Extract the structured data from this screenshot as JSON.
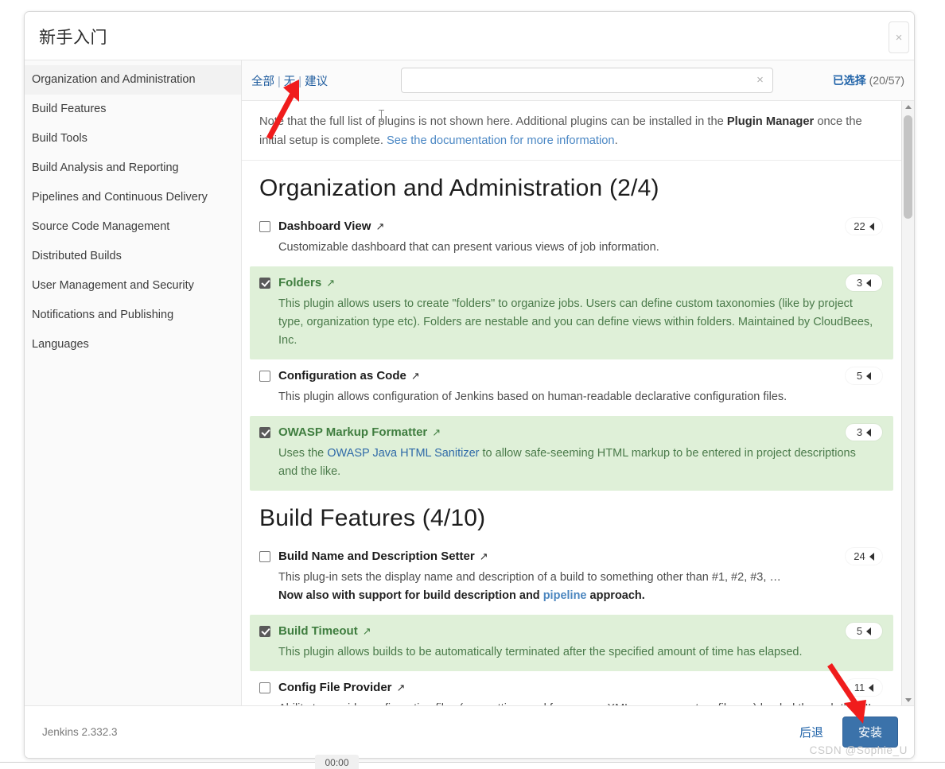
{
  "window": {
    "title": "新手入门",
    "close_label": "×"
  },
  "sidebar": {
    "items": [
      {
        "label": "Organization and Administration",
        "active": true
      },
      {
        "label": "Build Features",
        "active": false
      },
      {
        "label": "Build Tools",
        "active": false
      },
      {
        "label": "Build Analysis and Reporting",
        "active": false
      },
      {
        "label": "Pipelines and Continuous Delivery",
        "active": false
      },
      {
        "label": "Source Code Management",
        "active": false
      },
      {
        "label": "Distributed Builds",
        "active": false
      },
      {
        "label": "User Management and Security",
        "active": false
      },
      {
        "label": "Notifications and Publishing",
        "active": false
      },
      {
        "label": "Languages",
        "active": false
      }
    ]
  },
  "filterbar": {
    "all_label": "全部",
    "none_label": "无",
    "suggested_label": "建议",
    "separator": "|",
    "search_value": "",
    "search_placeholder": "",
    "clear_label": "×",
    "selected_label": "已选择",
    "selected_count": "(20/57)"
  },
  "note": {
    "part1": "Note that the full list of plugins is not shown here. Additional plugins can be installed in the ",
    "bold": "Plugin Manager",
    "part2": " once the initial setup is complete. ",
    "link": "See the documentation for more information",
    "part3": "."
  },
  "categories": [
    {
      "heading": "Organization and Administration (2/4)",
      "plugins": [
        {
          "name": "Dashboard View",
          "checked": false,
          "badge": "22",
          "desc_plain": "Customizable dashboard that can present various views of job information."
        },
        {
          "name": "Folders",
          "checked": true,
          "badge": "3",
          "desc_plain": "This plugin allows users to create \"folders\" to organize jobs. Users can define custom taxonomies (like by project type, organization type etc). Folders are nestable and you can define views within folders. Maintained by CloudBees, Inc."
        },
        {
          "name": "Configuration as Code",
          "checked": false,
          "badge": "5",
          "desc_plain": "This plugin allows configuration of Jenkins based on human-readable declarative configuration files."
        },
        {
          "name": "OWASP Markup Formatter",
          "checked": true,
          "badge": "3",
          "desc_pre": "Uses the ",
          "desc_link": "OWASP Java HTML Sanitizer",
          "desc_post": " to allow safe-seeming HTML markup to be entered in project descriptions and the like."
        }
      ]
    },
    {
      "heading": "Build Features (4/10)",
      "plugins": [
        {
          "name": "Build Name and Description Setter",
          "checked": false,
          "badge": "24",
          "desc_plain": "This plug-in sets the display name and description of a build to something other than #1, #2, #3, …",
          "desc_bold_pre": "Now also with support for build description and ",
          "desc_bold_link": "pipeline",
          "desc_bold_post": " approach."
        },
        {
          "name": "Build Timeout",
          "checked": true,
          "badge": "5",
          "desc_plain": "This plugin allows builds to be automatically terminated after the specified amount of time has elapsed."
        },
        {
          "name": "Config File Provider",
          "checked": false,
          "badge": "11",
          "desc_plain": "Ability to provide configuration files (e.g. settings.xml for maven, XML, groovy, custom files,…) loaded through the UI which will be copied to the job workspace."
        }
      ]
    }
  ],
  "footer": {
    "version": "Jenkins 2.332.3",
    "back_label": "后退",
    "install_label": "安装",
    "watermark": "CSDN @Sophie_U"
  },
  "taskbar": {
    "clock": "00:00"
  },
  "colors": {
    "accent_blue": "#3b72aa",
    "link_blue": "#2063a8",
    "selected_row_green": "#dff0d8",
    "selected_text_green": "#3f7d3f",
    "annotation_red": "#f01c1c"
  }
}
